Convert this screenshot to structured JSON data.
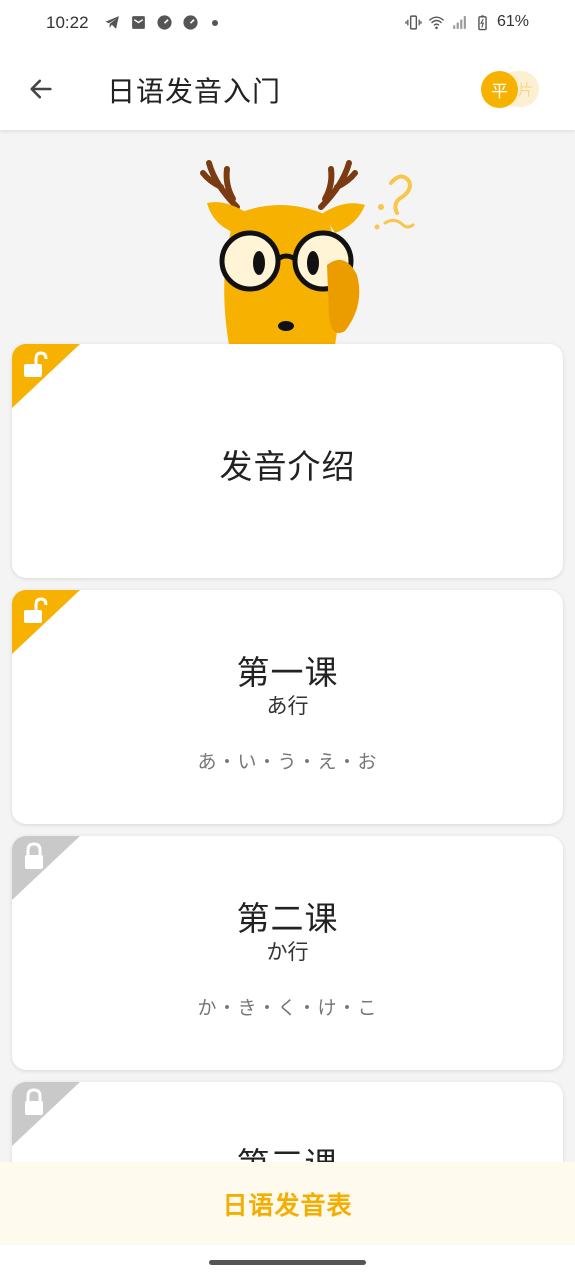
{
  "status_bar": {
    "time": "10:22",
    "battery": "61%",
    "icons": [
      "telegram-icon",
      "mail-icon",
      "speedometer-icon",
      "speedometer-icon",
      "more-dot-icon",
      "vibrate-icon",
      "wifi-icon",
      "signal-icon",
      "battery-icon"
    ]
  },
  "app_bar": {
    "title": "日语发音入门",
    "back_icon": "arrow-left-icon",
    "toggle_active": "平",
    "toggle_inactive": "片"
  },
  "colors": {
    "accent": "#f7b100",
    "unlocked_tag": "#f7b100",
    "locked_tag": "#c9c9c9",
    "bottom_bg": "#fefaed"
  },
  "lessons": [
    {
      "title": "发音介绍",
      "subtitle": "",
      "kana": "",
      "locked": false
    },
    {
      "title": "第一课",
      "subtitle": "あ行",
      "kana": "あ・い・う・え・お",
      "locked": false
    },
    {
      "title": "第二课",
      "subtitle": "か行",
      "kana": "か・き・く・け・こ",
      "locked": true
    },
    {
      "title": "第三课",
      "subtitle": "",
      "kana": "",
      "locked": true
    }
  ],
  "bottom_button": {
    "label": "日语发音表"
  }
}
